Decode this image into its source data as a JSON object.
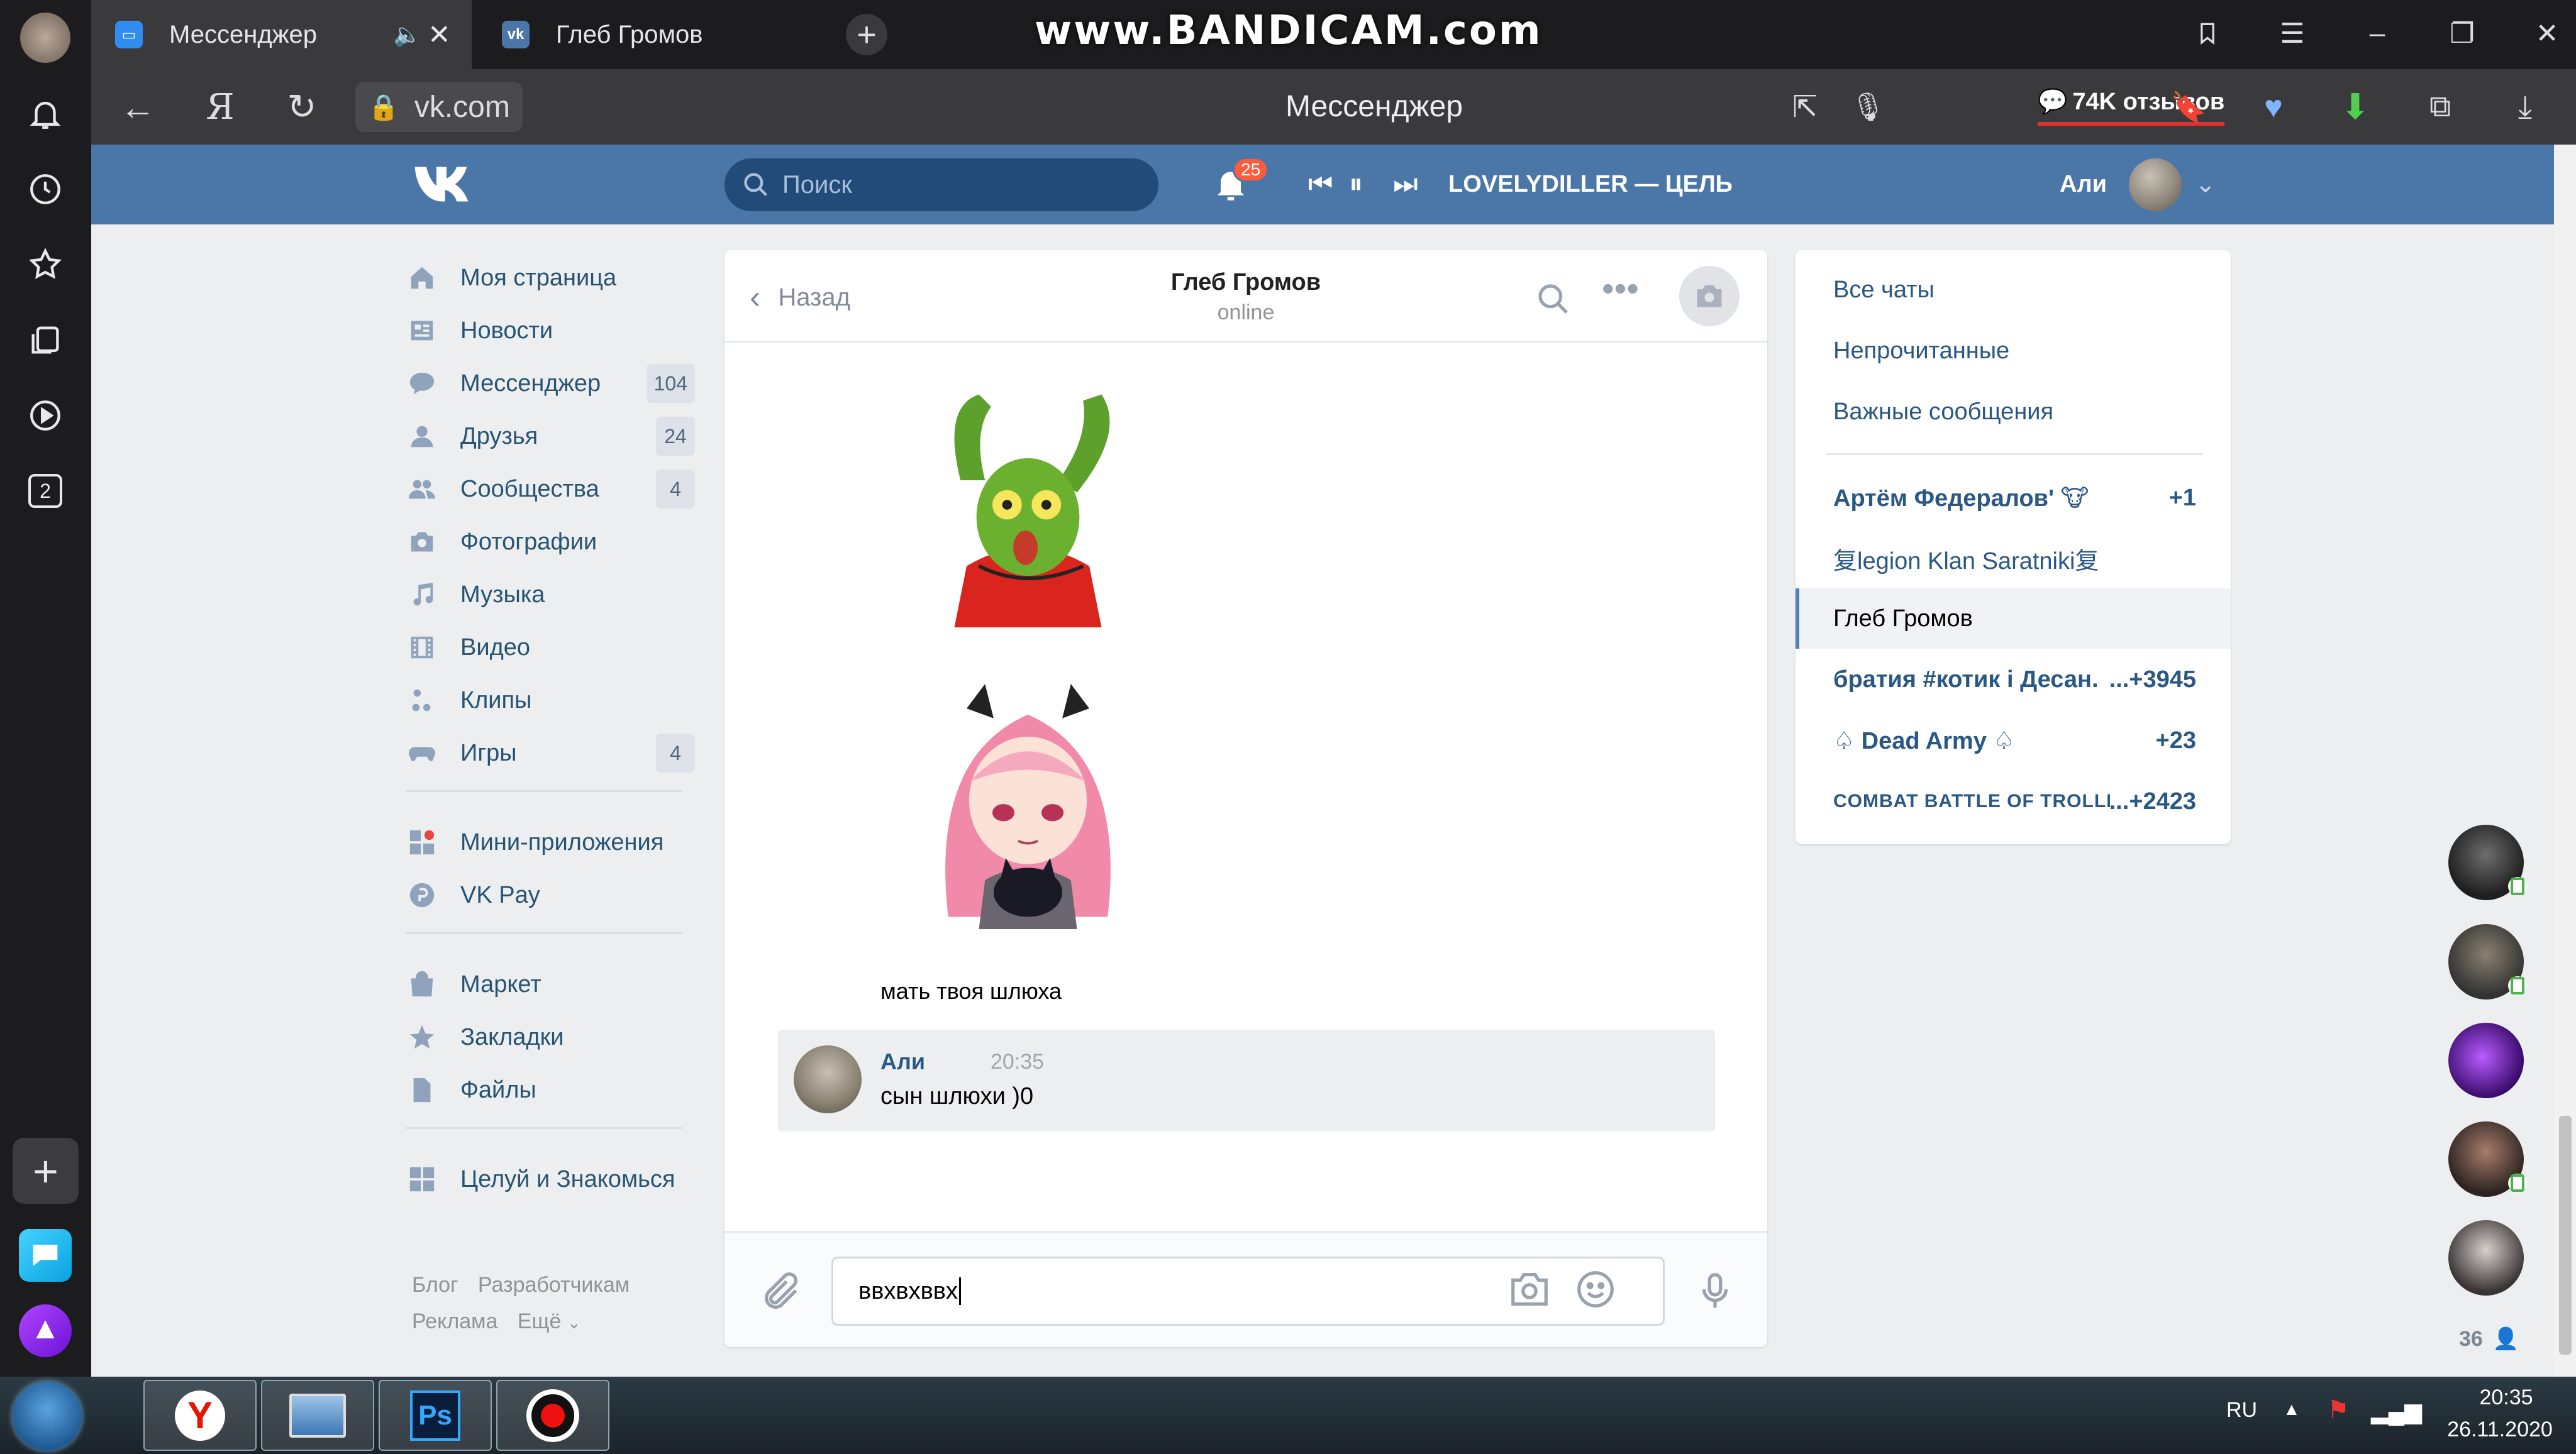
{
  "browser": {
    "tabs": [
      {
        "label": "Мессенджер",
        "active": true
      },
      {
        "label": "Глеб Громов",
        "active": false
      }
    ],
    "watermark": "www.BANDICAM.com",
    "url": "vk.com",
    "page_title": "Мессенджер",
    "reviews": "74K отзывов",
    "rail_badge": "2"
  },
  "vk_header": {
    "search_placeholder": "Поиск",
    "notifications_count": "25",
    "track": "LOVELYDILLER — ЦЕЛЬ",
    "user_name": "Али"
  },
  "left_menu": {
    "items": [
      {
        "label": "Моя страница",
        "icon": "home-icon"
      },
      {
        "label": "Новости",
        "icon": "news-icon"
      },
      {
        "label": "Мессенджер",
        "icon": "messenger-icon",
        "count": "104"
      },
      {
        "label": "Друзья",
        "icon": "friends-icon",
        "count": "24"
      },
      {
        "label": "Сообщества",
        "icon": "communities-icon",
        "count": "4"
      },
      {
        "label": "Фотографии",
        "icon": "camera-icon"
      },
      {
        "label": "Музыка",
        "icon": "music-icon"
      },
      {
        "label": "Видео",
        "icon": "video-icon"
      },
      {
        "label": "Клипы",
        "icon": "clips-icon"
      },
      {
        "label": "Игры",
        "icon": "gamepad-icon",
        "count": "4"
      },
      {
        "label": "Мини-приложения",
        "icon": "apps-icon"
      },
      {
        "label": "VK Pay",
        "icon": "vkpay-icon"
      },
      {
        "label": "Маркет",
        "icon": "bag-icon"
      },
      {
        "label": "Закладки",
        "icon": "star-icon"
      },
      {
        "label": "Файлы",
        "icon": "file-icon"
      },
      {
        "label": "Целуй и Знакомься",
        "icon": "apps-icon"
      }
    ],
    "footer": {
      "blog": "Блог",
      "developers": "Разработчикам",
      "ads": "Реклама",
      "more": "Ещё"
    }
  },
  "chat": {
    "back_label": "Назад",
    "peer_name": "Глеб Громов",
    "peer_status": "online",
    "message_incoming": "мать твоя шлюха",
    "message_outgoing": {
      "author": "Али",
      "time": "20:35",
      "text": "сын шлюхи )0"
    },
    "input_value": "ввхвхввх"
  },
  "chat_list": {
    "filters": [
      "Все чаты",
      "Непрочитанные",
      "Важные сообщения"
    ],
    "dialogs": [
      {
        "name": "Артём Федералов' 🐮",
        "count": "+1"
      },
      {
        "name": "复legion Klan Saratniki复",
        "count": ""
      },
      {
        "name": "Глеб Громов",
        "count": "",
        "selected": true
      },
      {
        "name": "братия #котик і Десан...",
        "count": "...+3945"
      },
      {
        "name": "♤ Dead Army ♤",
        "count": "+23"
      },
      {
        "name": "COMBAT BATTLE OF TROLLI...",
        "count": "...+2423"
      }
    ]
  },
  "friends_online_count": "36",
  "taskbar": {
    "lang": "RU",
    "time": "20:35",
    "date": "26.11.2020"
  },
  "colors": {
    "vk_blue": "#4a76a8",
    "link": "#2a5885",
    "badge": "#ff5c3c"
  }
}
